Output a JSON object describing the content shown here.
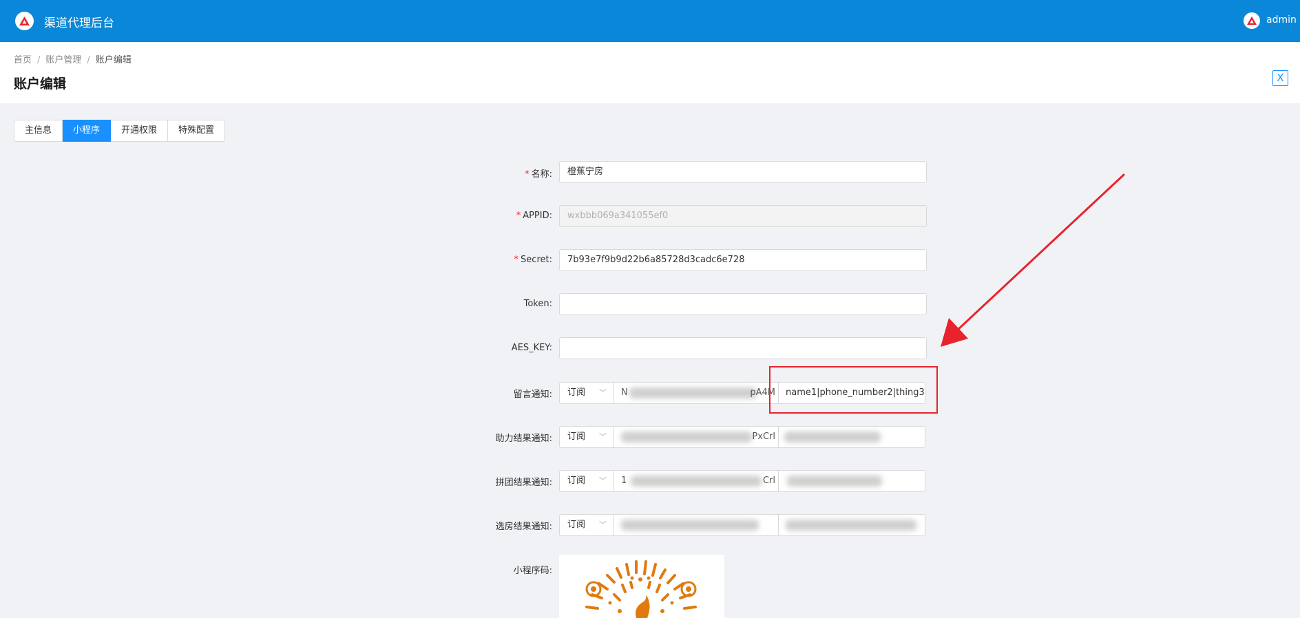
{
  "app": {
    "title": "渠道代理后台",
    "user": "admin"
  },
  "breadcrumb": [
    "首页",
    "账户管理",
    "账户编辑"
  ],
  "page": {
    "title": "账户编辑",
    "close_label": "X"
  },
  "tabs": [
    {
      "label": "主信息",
      "active": false
    },
    {
      "label": "小程序",
      "active": true
    },
    {
      "label": "开通权限",
      "active": false
    },
    {
      "label": "特殊配置",
      "active": false
    }
  ],
  "form": {
    "name": {
      "label": "名称",
      "value": "橙蕉宁房"
    },
    "appid": {
      "label": "APPID",
      "value": "wxbbb069a341055ef0"
    },
    "secret": {
      "label": "Secret",
      "value": "7b93e7f9b9d22b6a85728d3cadc6e728"
    },
    "token": {
      "label": "Token",
      "value": ""
    },
    "aes_key": {
      "label": "AES_KEY",
      "value": ""
    },
    "qrcode": {
      "label": "小程序码"
    }
  },
  "notifications": [
    {
      "label": "留言通知",
      "type": "订阅",
      "template_prefix": "N",
      "template_suffix": "pA4M",
      "fields": "name1|phone_number2|thing3"
    },
    {
      "label": "助力结果通知",
      "type": "订阅",
      "template_prefix": "",
      "template_suffix": "PxCrl",
      "fields": ""
    },
    {
      "label": "拼团结果通知",
      "type": "订阅",
      "template_prefix": "1",
      "template_suffix": "Crl",
      "fields": ""
    },
    {
      "label": "选房结果通知",
      "type": "订阅",
      "template_prefix": "",
      "template_suffix": "",
      "fields": ""
    }
  ],
  "colors": {
    "header": "#0a87d8",
    "primary": "#1890ff",
    "required": "#f5222d",
    "annotation": "#e8232d",
    "qr": "#e07a10"
  },
  "icons": {
    "logo": "triangle-logo-icon",
    "select": "chevron-down-icon",
    "close": "close-icon"
  }
}
